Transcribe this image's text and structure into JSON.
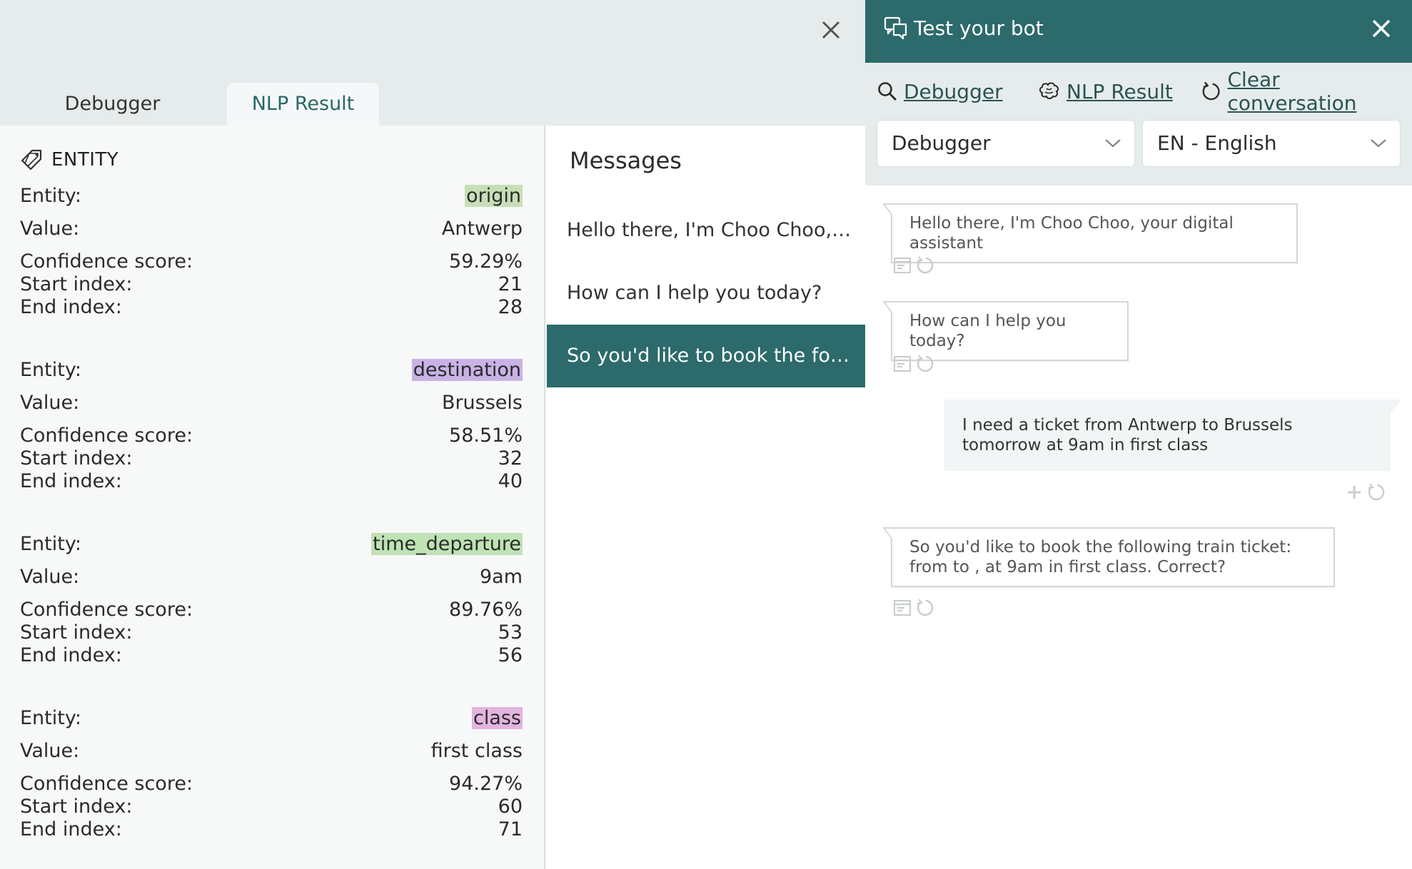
{
  "debug_panel": {
    "tabs": [
      "Debugger",
      "NLP Result"
    ],
    "active_tab": "NLP Result",
    "entity_section": {
      "header": "ENTITY",
      "labels": {
        "entity": "Entity:",
        "value": "Value:",
        "confidence": "Confidence score:",
        "start": "Start index:",
        "end": "End index:"
      },
      "entities": [
        {
          "name": "origin",
          "value": "Antwerp",
          "confidence": "59.29%",
          "start": "21",
          "end": "28",
          "highlight": "#c7dfb7"
        },
        {
          "name": "destination",
          "value": "Brussels",
          "confidence": "58.51%",
          "start": "32",
          "end": "40",
          "highlight": "#c9b3e6"
        },
        {
          "name": "time_departure",
          "value": "9am",
          "confidence": "89.76%",
          "start": "53",
          "end": "56",
          "highlight": "#bfe3b4"
        },
        {
          "name": "class",
          "value": "first class",
          "confidence": "94.27%",
          "start": "60",
          "end": "71",
          "highlight": "#e3b4e0"
        }
      ]
    },
    "messages": {
      "title": "Messages",
      "items": [
        "Hello there, I'm Choo Choo, y...",
        "How can I help you today?",
        "So you'd like to book the follo..."
      ],
      "active_index": 2
    }
  },
  "bot_panel": {
    "title": "Test your bot",
    "toolbar": {
      "debugger": "Debugger",
      "nlp_result": "NLP Result",
      "clear": "Clear conversation"
    },
    "mode_select": "Debugger",
    "language_select": "EN - English",
    "chat": [
      {
        "from": "bot",
        "text": "Hello there, I'm Choo Choo, your digital assistant"
      },
      {
        "from": "bot",
        "text": "How can I help you today?"
      },
      {
        "from": "user",
        "text": "I need a ticket from Antwerp to Brussels tomorrow at 9am in first class"
      },
      {
        "from": "bot",
        "text": "So you'd like to book the following train ticket: from to , at 9am in first class. Correct?"
      }
    ]
  },
  "colors": {
    "primary": "#2c6a6b",
    "header_bg": "#e6ecec"
  }
}
